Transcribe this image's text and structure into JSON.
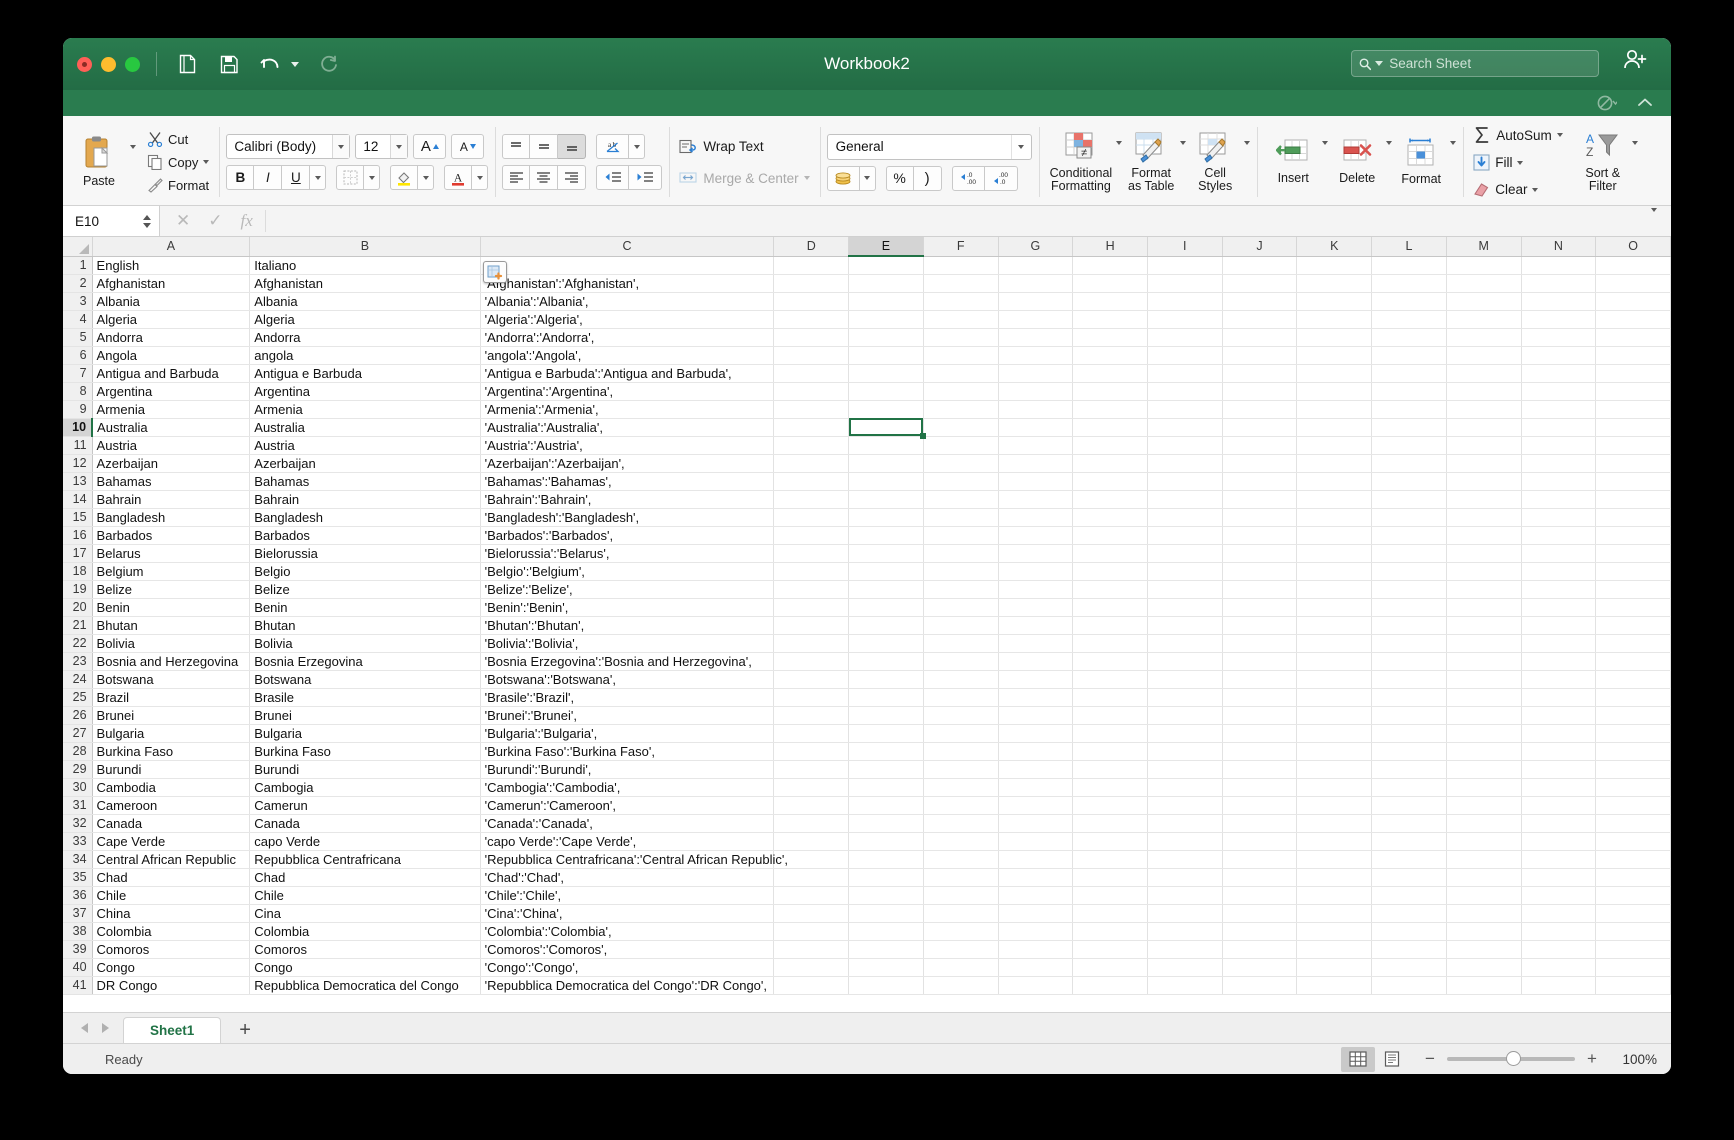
{
  "window": {
    "title": "Workbook2",
    "traffic_lights": [
      "close",
      "minimize",
      "maximize"
    ]
  },
  "quick_access": {
    "new_label": "new-document",
    "save_label": "save",
    "undo_label": "undo",
    "redo_label": "redo"
  },
  "search": {
    "placeholder": "Search Sheet",
    "value": ""
  },
  "ribbon": {
    "clipboard": {
      "paste": "Paste",
      "cut": "Cut",
      "copy": "Copy",
      "format": "Format"
    },
    "font": {
      "family": "Calibri (Body)",
      "size": "12",
      "grow": "A",
      "shrink": "A",
      "bold": "B",
      "italic": "I",
      "underline": "U"
    },
    "alignment": {
      "wrap_text": "Wrap Text",
      "merge_center": "Merge & Center"
    },
    "number": {
      "format": "General",
      "percent": "%"
    },
    "styles": {
      "conditional_formatting": "Conditional\nFormatting",
      "conditional_l1": "Conditional",
      "conditional_l2": "Formatting",
      "format_as_table_l1": "Format",
      "format_as_table_l2": "as Table",
      "cell_styles_l1": "Cell",
      "cell_styles_l2": "Styles"
    },
    "cells": {
      "insert": "Insert",
      "delete": "Delete",
      "format": "Format"
    },
    "editing": {
      "autosum": "AutoSum",
      "fill": "Fill",
      "clear": "Clear",
      "sort_filter_l1": "Sort &",
      "sort_filter_l2": "Filter"
    }
  },
  "formula_bar": {
    "name_box": "E10",
    "value": "",
    "cancel": "✕",
    "enter": "✓",
    "fx": "fx"
  },
  "grid": {
    "columns": [
      "A",
      "B",
      "C",
      "D",
      "E",
      "F",
      "G",
      "H",
      "I",
      "J",
      "K",
      "L",
      "M",
      "N",
      "O"
    ],
    "selected_column": "E",
    "selected_row": 10,
    "selected_cell": "E10",
    "rows": [
      {
        "n": 1,
        "a": "English",
        "b": "Italiano",
        "c": ""
      },
      {
        "n": 2,
        "a": "Afghanistan",
        "b": "Afghanistan",
        "c": "'Afghanistan':'Afghanistan',"
      },
      {
        "n": 3,
        "a": "Albania",
        "b": "Albania",
        "c": "'Albania':'Albania',"
      },
      {
        "n": 4,
        "a": "Algeria",
        "b": "Algeria",
        "c": "'Algeria':'Algeria',"
      },
      {
        "n": 5,
        "a": "Andorra",
        "b": "Andorra",
        "c": "'Andorra':'Andorra',"
      },
      {
        "n": 6,
        "a": "Angola",
        "b": "angola",
        "c": "'angola':'Angola',"
      },
      {
        "n": 7,
        "a": "Antigua and Barbuda",
        "b": "Antigua e Barbuda",
        "c": "'Antigua e Barbuda':'Antigua and Barbuda',"
      },
      {
        "n": 8,
        "a": "Argentina",
        "b": "Argentina",
        "c": "'Argentina':'Argentina',"
      },
      {
        "n": 9,
        "a": "Armenia",
        "b": "Armenia",
        "c": "'Armenia':'Armenia',"
      },
      {
        "n": 10,
        "a": "Australia",
        "b": "Australia",
        "c": "'Australia':'Australia',"
      },
      {
        "n": 11,
        "a": "Austria",
        "b": "Austria",
        "c": "'Austria':'Austria',"
      },
      {
        "n": 12,
        "a": "Azerbaijan",
        "b": "Azerbaijan",
        "c": "'Azerbaijan':'Azerbaijan',"
      },
      {
        "n": 13,
        "a": "Bahamas",
        "b": "Bahamas",
        "c": "'Bahamas':'Bahamas',"
      },
      {
        "n": 14,
        "a": "Bahrain",
        "b": "Bahrain",
        "c": "'Bahrain':'Bahrain',"
      },
      {
        "n": 15,
        "a": "Bangladesh",
        "b": "Bangladesh",
        "c": "'Bangladesh':'Bangladesh',"
      },
      {
        "n": 16,
        "a": "Barbados",
        "b": "Barbados",
        "c": "'Barbados':'Barbados',"
      },
      {
        "n": 17,
        "a": "Belarus",
        "b": "Bielorussia",
        "c": "'Bielorussia':'Belarus',"
      },
      {
        "n": 18,
        "a": "Belgium",
        "b": "Belgio",
        "c": "'Belgio':'Belgium',"
      },
      {
        "n": 19,
        "a": "Belize",
        "b": "Belize",
        "c": "'Belize':'Belize',"
      },
      {
        "n": 20,
        "a": "Benin",
        "b": "Benin",
        "c": "'Benin':'Benin',"
      },
      {
        "n": 21,
        "a": "Bhutan",
        "b": "Bhutan",
        "c": "'Bhutan':'Bhutan',"
      },
      {
        "n": 22,
        "a": "Bolivia",
        "b": "Bolivia",
        "c": "'Bolivia':'Bolivia',"
      },
      {
        "n": 23,
        "a": "Bosnia and Herzegovina",
        "b": "Bosnia Erzegovina",
        "c": "'Bosnia Erzegovina':'Bosnia and Herzegovina',"
      },
      {
        "n": 24,
        "a": "Botswana",
        "b": "Botswana",
        "c": "'Botswana':'Botswana',"
      },
      {
        "n": 25,
        "a": "Brazil",
        "b": "Brasile",
        "c": "'Brasile':'Brazil',"
      },
      {
        "n": 26,
        "a": "Brunei",
        "b": "Brunei",
        "c": "'Brunei':'Brunei',"
      },
      {
        "n": 27,
        "a": "Bulgaria",
        "b": "Bulgaria",
        "c": "'Bulgaria':'Bulgaria',"
      },
      {
        "n": 28,
        "a": "Burkina Faso",
        "b": "Burkina Faso",
        "c": "'Burkina Faso':'Burkina Faso',"
      },
      {
        "n": 29,
        "a": "Burundi",
        "b": "Burundi",
        "c": "'Burundi':'Burundi',"
      },
      {
        "n": 30,
        "a": "Cambodia",
        "b": "Cambogia",
        "c": "'Cambogia':'Cambodia',"
      },
      {
        "n": 31,
        "a": "Cameroon",
        "b": "Camerun",
        "c": "'Camerun':'Cameroon',"
      },
      {
        "n": 32,
        "a": "Canada",
        "b": "Canada",
        "c": "'Canada':'Canada',"
      },
      {
        "n": 33,
        "a": "Cape Verde",
        "b": "capo Verde",
        "c": "'capo Verde':'Cape Verde',"
      },
      {
        "n": 34,
        "a": "Central African Republic",
        "b": "Repubblica Centrafricana",
        "c": "'Repubblica Centrafricana':'Central African Republic',"
      },
      {
        "n": 35,
        "a": "Chad",
        "b": "Chad",
        "c": "'Chad':'Chad',"
      },
      {
        "n": 36,
        "a": "Chile",
        "b": "Chile",
        "c": "'Chile':'Chile',"
      },
      {
        "n": 37,
        "a": "China",
        "b": "Cina",
        "c": "'Cina':'China',"
      },
      {
        "n": 38,
        "a": "Colombia",
        "b": "Colombia",
        "c": "'Colombia':'Colombia',"
      },
      {
        "n": 39,
        "a": "Comoros",
        "b": "Comoros",
        "c": "'Comoros':'Comoros',"
      },
      {
        "n": 40,
        "a": "Congo",
        "b": "Congo",
        "c": "'Congo':'Congo',"
      },
      {
        "n": 41,
        "a": "DR Congo",
        "b": "Repubblica Democratica del Congo",
        "c": "'Repubblica Democratica del Congo':'DR Congo',"
      }
    ]
  },
  "sheet_tabs": {
    "active": "Sheet1",
    "add": "+"
  },
  "status_bar": {
    "message": "Ready",
    "zoom": "100%"
  },
  "colors": {
    "accent": "#217346",
    "titlebar_top": "#2a7c4f",
    "titlebar_bottom": "#236c45",
    "selection": "#217346"
  }
}
